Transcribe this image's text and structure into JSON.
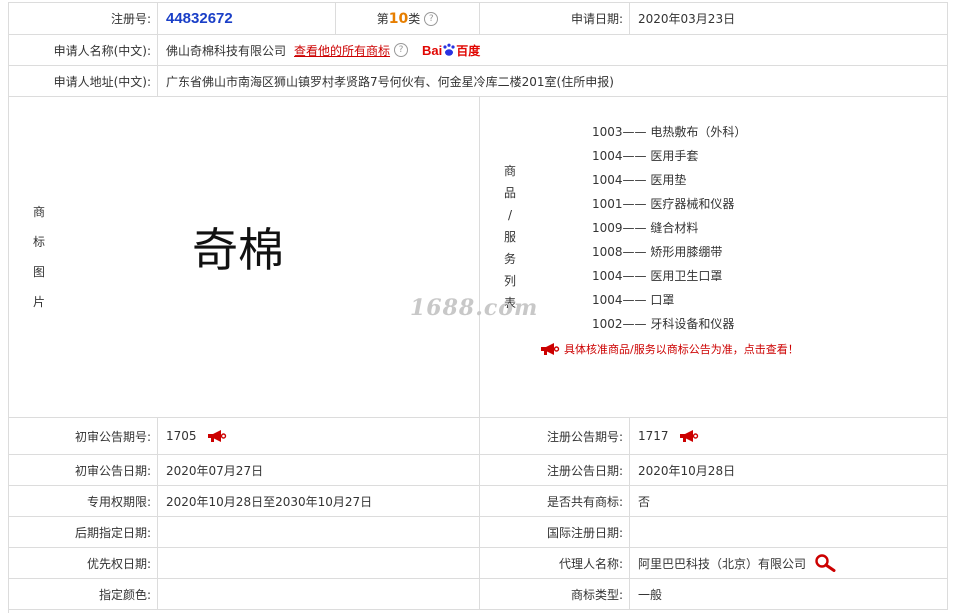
{
  "row1": {
    "regno_label": "注册号:",
    "regno_value": "44832672",
    "class_prefix": "第",
    "class_num": "10",
    "class_suffix": "类",
    "apply_date_label": "申请日期:",
    "apply_date_value": "2020年03月23日"
  },
  "row2": {
    "applicant_label": "申请人名称(中文):",
    "applicant_value": "佛山奇棉科技有限公司",
    "view_all_link": "查看他的所有商标",
    "baidu_latin": "Bai",
    "baidu_cn": "百度"
  },
  "row3": {
    "address_label": "申请人地址(中文):",
    "address_value": "广东省佛山市南海区狮山镇罗村孝贤路7号何伙有、何金星冷库二楼201室(住所申报)"
  },
  "mark": {
    "label_chars": [
      "商",
      "标",
      "图",
      "片"
    ],
    "logo_text": "奇棉",
    "watermark": "1688.com"
  },
  "services": {
    "label_chars": [
      "商",
      "品",
      "/",
      "服",
      "务",
      "列",
      "表"
    ],
    "items": [
      "1003—— 电热敷布（外科）",
      "1004—— 医用手套",
      "1004—— 医用垫",
      "1001—— 医疗器械和仪器",
      "1009—— 缝合材料",
      "1008—— 矫形用膝绷带",
      "1004—— 医用卫生口罩",
      "1004—— 口罩",
      "1002—— 牙科设备和仪器"
    ],
    "note": "具体核准商品/服务以商标公告为准，点击查看！"
  },
  "details": [
    {
      "l_label": "初审公告期号:",
      "l_value": "1705",
      "r_label": "注册公告期号:",
      "r_value": "1717"
    },
    {
      "l_label": "初审公告日期:",
      "l_value": "2020年07月27日",
      "r_label": "注册公告日期:",
      "r_value": "2020年10月28日"
    },
    {
      "l_label": "专用权期限:",
      "l_value": "2020年10月28日至2030年10月27日",
      "r_label": "是否共有商标:",
      "r_value": "否"
    },
    {
      "l_label": "后期指定日期:",
      "l_value": "",
      "r_label": "国际注册日期:",
      "r_value": ""
    },
    {
      "l_label": "优先权日期:",
      "l_value": "",
      "r_label": "代理人名称:",
      "r_value": "阿里巴巴科技（北京）有限公司"
    },
    {
      "l_label": "指定颜色:",
      "l_value": "",
      "r_label": "商标类型:",
      "r_value": "一般"
    }
  ],
  "colors": {
    "regno": "#1a3fc7",
    "class_num": "#e67e00",
    "link_red": "#c00000",
    "border": "#dcdcdc"
  },
  "icons": [
    "help-icon",
    "baidu-paw-icon",
    "megaphone-icon",
    "magnifier-icon"
  ]
}
